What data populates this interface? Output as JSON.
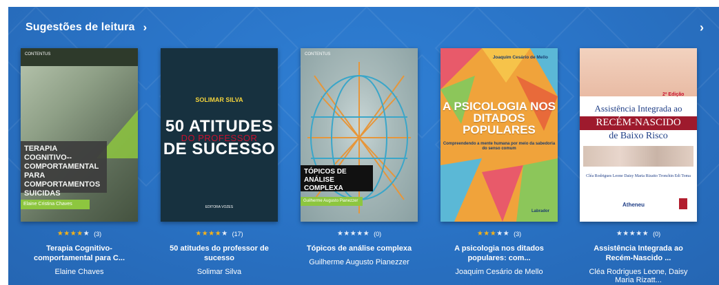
{
  "header": {
    "title": "Sugestões de leitura",
    "chevron": "›",
    "next": "›"
  },
  "colors": {
    "background": "#2a74c7",
    "star_on": "#f5b21a",
    "star_off": "#e8eef8"
  },
  "books": [
    {
      "rating_count": "(3)",
      "stars": 4,
      "title": "Terapia Cognitivo-comportamental para C...",
      "author": "Elaine Chaves",
      "cover": {
        "logo": "CONTENTUS",
        "title": "TERAPIA COGNITIVO--COMPORTAMENTAL PARA COMPORTAMENTOS SUICIDAS",
        "author": "Elaine Cristina Chaves"
      }
    },
    {
      "rating_count": "(17)",
      "stars": 4,
      "title": "50 atitudes do professor de sucesso",
      "author": "Solimar Silva",
      "cover": {
        "author": "SOLIMAR SILVA",
        "line1": "50 ATITUDES",
        "line2": "DO PROFESSOR",
        "line3": "DE SUCESSO",
        "publisher": "EDITORA VOZES"
      }
    },
    {
      "rating_count": "(0)",
      "stars": 0,
      "title": "Tópicos de análise complexa",
      "author": "Guilherme Augusto Pianezzer",
      "cover": {
        "logo": "CONTENTUS",
        "title": "TÓPICOS DE ANÁLISE COMPLEXA",
        "author": "Guilherme Augusto Pianezzer"
      }
    },
    {
      "rating_count": "(3)",
      "stars": 3,
      "title": "A psicologia nos ditados populares: com...",
      "author": "Joaquim Cesário de Mello",
      "cover": {
        "author": "Joaquim Cesário de Mello",
        "title": "A PSICOLOGIA NOS DITADOS POPULARES",
        "subtitle": "Compreendendo a mente humana por meio da sabedoria do senso comum",
        "publisher": "Labrador"
      }
    },
    {
      "rating_count": "(0)",
      "stars": 0,
      "title": "Assistência Integrada ao Recém-Nascido ...",
      "author": "Cléa Rodrigues Leone, Daisy Maria Rizatt...",
      "cover": {
        "edition": "2ª Edição",
        "line1": "Assistência Integrada ao",
        "line2": "RECÉM-NASCIDO",
        "line3": "de Baixo Risco",
        "authors": "Cléa Rodrigues Leone Daisy Maria Rizatto Tronchin Edi Toma",
        "publisher": "Atheneu"
      }
    }
  ]
}
